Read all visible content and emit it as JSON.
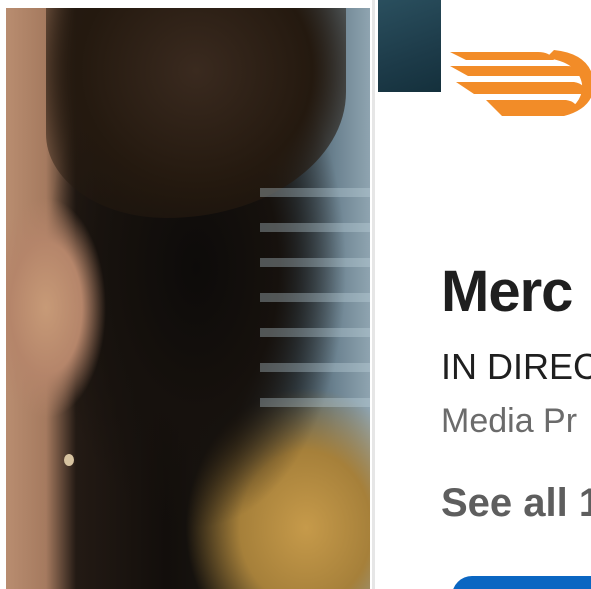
{
  "company": {
    "name": "Merc",
    "status": "IN DIREC",
    "category": "Media Pr",
    "see_all_label": "See all 1"
  },
  "colors": {
    "logo_orange": "#f28c28",
    "button_blue": "#0a66c2",
    "text_dark": "#1f1f1f",
    "text_muted": "#6b6b6b"
  },
  "icons": {
    "logo": "winged-logo-icon"
  }
}
